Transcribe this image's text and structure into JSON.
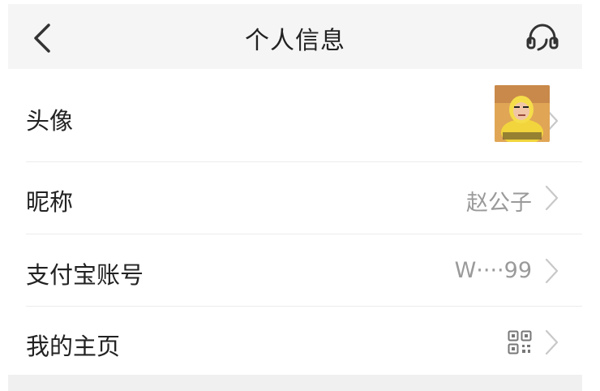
{
  "header": {
    "title": "个人信息",
    "back_icon": "chevron-left-icon",
    "service_icon": "headset-icon"
  },
  "rows": [
    {
      "label": "头像",
      "value": "",
      "trailing": "avatar-image"
    },
    {
      "label": "昵称",
      "value": "赵公子"
    },
    {
      "label": "支付宝账号",
      "value": "W····99"
    },
    {
      "label": "我的主页",
      "value": "",
      "trailing": "qr-code-icon"
    }
  ],
  "colors": {
    "header_bg": "#f5f5f5",
    "text": "#222222",
    "secondary_text": "#9a9a9a",
    "chevron": "#c8c8c8",
    "divider": "#ececec"
  }
}
